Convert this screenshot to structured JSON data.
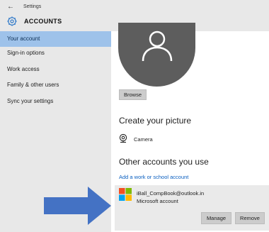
{
  "window": {
    "app_title": "Settings",
    "section_title": "ACCOUNTS"
  },
  "icons": {
    "back": "back-arrow-icon",
    "section": "gear-icon",
    "avatar": "user-silhouette-icon",
    "camera": "camera-icon",
    "account_logo": "microsoft-logo-icon",
    "pointer": "pointer-arrow-icon"
  },
  "sidebar": {
    "items": [
      {
        "label": "Your account",
        "active": true
      },
      {
        "label": "Sign-in options",
        "active": false
      },
      {
        "label": "Work access",
        "active": false
      },
      {
        "label": "Family & other users",
        "active": false
      },
      {
        "label": "Sync your settings",
        "active": false
      }
    ]
  },
  "main": {
    "browse_label": "Browse",
    "create_picture_title": "Create your picture",
    "camera_label": "Camera",
    "other_accounts_title": "Other accounts you use",
    "add_account_link": "Add a work or school account",
    "account": {
      "email": "iBall_CompBook@outlook.in",
      "type": "Microsoft account",
      "manage_label": "Manage",
      "remove_label": "Remove"
    }
  },
  "colors": {
    "sidebar_bg": "#e8e8e8",
    "active_item": "#9ec2ea",
    "accent_blue": "#2f79c9",
    "link": "#0a5fc0",
    "avatar_bg": "#5d5d5d",
    "arrow": "#4472c4",
    "ms_red": "#f25022",
    "ms_green": "#7fba00",
    "ms_blue": "#00a4ef",
    "ms_yellow": "#ffb900"
  }
}
